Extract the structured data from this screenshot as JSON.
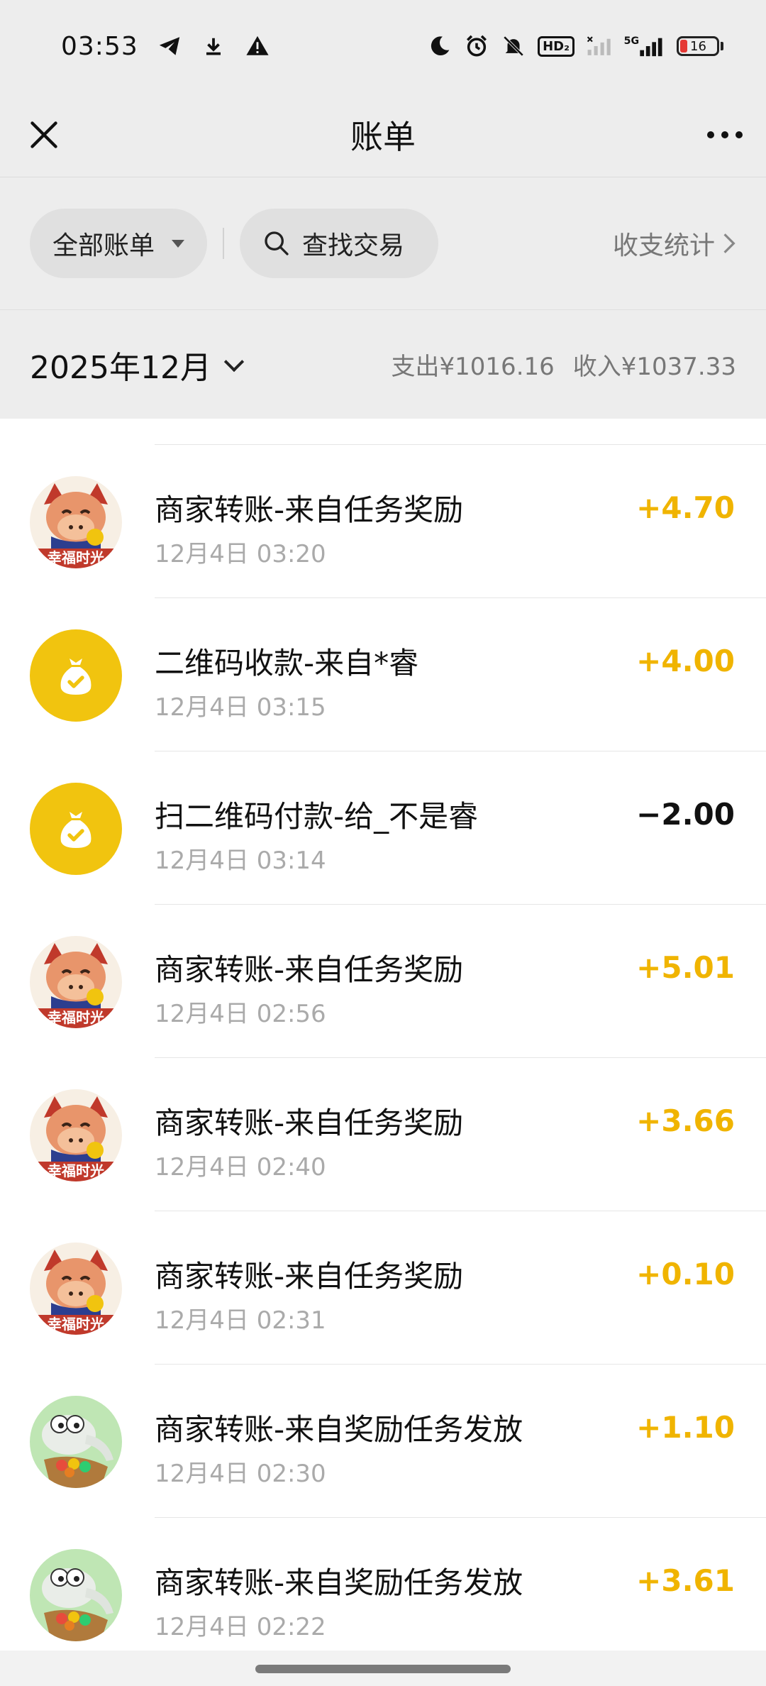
{
  "status_bar": {
    "time": "03:53",
    "icons": [
      "telegram-icon",
      "download-icon",
      "warning-icon",
      "moon-icon",
      "alarm-icon",
      "mute-icon",
      "hd-icon",
      "signal-icon",
      "5g-signal-icon",
      "battery-icon"
    ],
    "hd_label": "HD₂",
    "network_label": "5G",
    "battery_level": "16",
    "battery_color": "#e53935"
  },
  "nav": {
    "title": "账单",
    "close_icon": "close-icon",
    "more_icon": "more-icon"
  },
  "filters": {
    "all_bills": "全部账单",
    "search": "查找交易",
    "stats": "收支统计"
  },
  "month": {
    "label": "2025年12月",
    "expense": "支出¥1016.16",
    "income": "收入¥1037.33"
  },
  "colors": {
    "income": "#f0b400",
    "expense": "#111111",
    "money_bag": "#f1c40f"
  },
  "transactions": [
    {
      "avatar": "dragon-avatar",
      "title": "商家转账-来自任务奖励",
      "time": "12月4日 03:20",
      "amount": "+4.70",
      "type": "income"
    },
    {
      "avatar": "money-bag-icon",
      "title": "二维码收款-来自*睿",
      "time": "12月4日 03:15",
      "amount": "+4.00",
      "type": "income"
    },
    {
      "avatar": "money-bag-icon",
      "title": "扫二维码付款-给_不是睿",
      "time": "12月4日 03:14",
      "amount": "−2.00",
      "type": "expense"
    },
    {
      "avatar": "dragon-avatar",
      "title": "商家转账-来自任务奖励",
      "time": "12月4日 02:56",
      "amount": "+5.01",
      "type": "income"
    },
    {
      "avatar": "dragon-avatar",
      "title": "商家转账-来自任务奖励",
      "time": "12月4日 02:40",
      "amount": "+3.66",
      "type": "income"
    },
    {
      "avatar": "dragon-avatar",
      "title": "商家转账-来自任务奖励",
      "time": "12月4日 02:31",
      "amount": "+0.10",
      "type": "income"
    },
    {
      "avatar": "anteater-avatar",
      "title": "商家转账-来自奖励任务发放",
      "time": "12月4日 02:30",
      "amount": "+1.10",
      "type": "income"
    },
    {
      "avatar": "anteater-avatar",
      "title": "商家转账-来自奖励任务发放",
      "time": "12月4日 02:22",
      "amount": "+3.61",
      "type": "income"
    }
  ]
}
